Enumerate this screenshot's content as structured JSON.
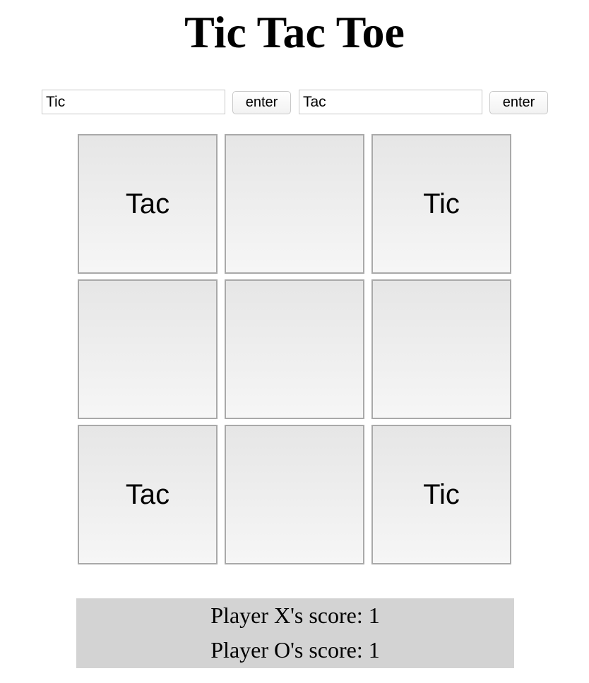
{
  "title": "Tic Tac Toe",
  "players": {
    "x": {
      "name_value": "Tic",
      "enter_label": "enter"
    },
    "o": {
      "name_value": "Tac",
      "enter_label": "enter"
    }
  },
  "board": {
    "cells": [
      "Tac",
      "",
      "Tic",
      "",
      "",
      "",
      "Tac",
      "",
      "Tic"
    ]
  },
  "scores": {
    "x_text": "Player X's score: 1",
    "o_text": "Player O's score: 1"
  }
}
